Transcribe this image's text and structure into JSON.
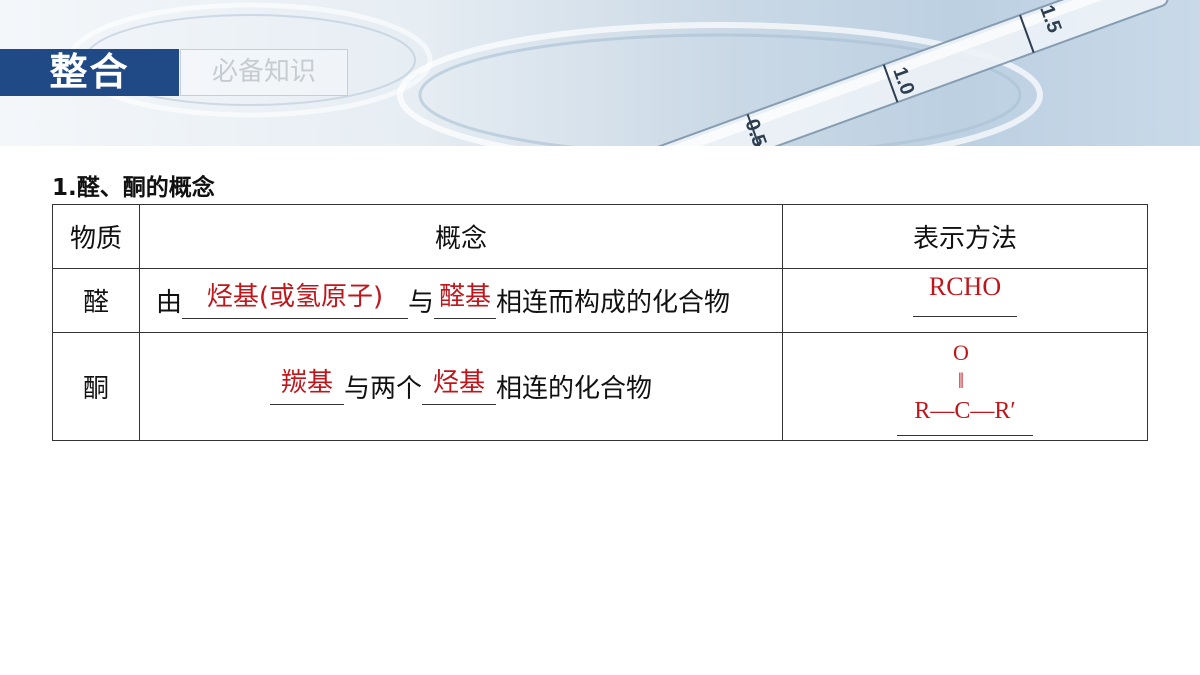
{
  "header": {
    "tag_main": "整合",
    "tag_sub": "必备知识",
    "pipette_marks": [
      "1.5",
      "1.0",
      "0.5"
    ]
  },
  "section": {
    "title": "1.醛、酮的概念"
  },
  "table": {
    "headers": [
      "物质",
      "概念",
      "表示方法"
    ],
    "rows": [
      {
        "substance": "醛",
        "concept_prefix": "由",
        "blank1": "烃基(或氢原子)",
        "concept_mid": "与",
        "blank2": "醛基",
        "concept_suffix": "相连而构成的化合物",
        "representation": "RCHO"
      },
      {
        "substance": "酮",
        "blank1": "羰基",
        "concept_mid": "与两个",
        "blank2": "烃基",
        "concept_suffix": "相连的化合物",
        "formula": {
          "top": "O",
          "bond": "‖",
          "bottom": "R—C—R′"
        }
      }
    ]
  },
  "colors": {
    "tag_blue": "#1f4a86",
    "answer_red": "#c0161b"
  }
}
